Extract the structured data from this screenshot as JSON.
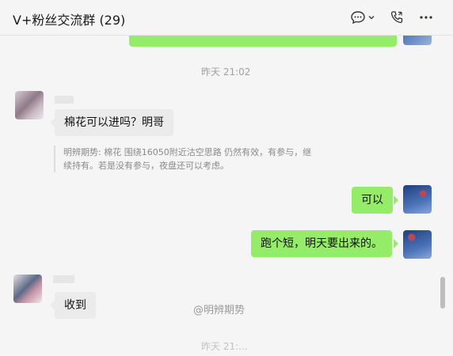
{
  "header": {
    "title": "V+粉丝交流群 (29)",
    "icons": [
      "chat-bubble-icon",
      "chevron-down-icon",
      "phone-call-icon",
      "more-icon"
    ]
  },
  "messages": {
    "timestamp": "昨天 21:02",
    "m1_text": "棉花可以进吗？明哥",
    "m1_quote": "明辨期势: 棉花 围绕16050附近沽空思路 仍然有效，有参与，继续持有。若是没有参与，夜盘还可以考虑。",
    "m2_text": "可以",
    "m3_text": "跑个短，明天要出来的。",
    "m4_text": "收到",
    "bottom_time": "昨天 21:..."
  },
  "watermark": "@明辨期势",
  "colors": {
    "self_bubble": "#95ec69",
    "other_bubble": "#ebebeb",
    "background": "#f5f5f5"
  }
}
